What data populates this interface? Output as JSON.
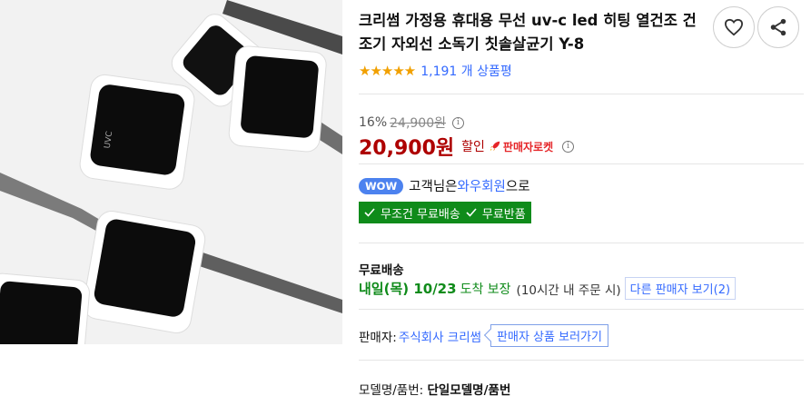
{
  "product": {
    "title": "크리썸 가정용 휴대용 무선 uv-c led 히팅 열건조 건조기 자외선 소독기 칫솔살균기 Y-8",
    "image_alt": "UVC 칫솔살균기 제품 이미지",
    "device_label": "UVC"
  },
  "actions": {
    "heart_icon": "heart-icon",
    "share_icon": "share-icon"
  },
  "rating": {
    "stars": "★★★★★",
    "review_count": "1,191 개 상품평"
  },
  "price": {
    "discount_rate": "16%",
    "original_price": "24,900원",
    "sale_price": "20,900원",
    "sale_tag": "할인",
    "seller_rocket": "판매자로켓"
  },
  "wow": {
    "badge": "WOW",
    "prefix": "고객님은",
    "link": "와우회원",
    "suffix": "으로"
  },
  "benefits": {
    "free_shipping": "무조건 무료배송",
    "free_return": "무료반품"
  },
  "shipping": {
    "title": "무료배송",
    "date": "내일(목) 10/23",
    "guarantee": "도착 보장",
    "note": "(10시간 내 주문 시)",
    "other_sellers_label": "다른 판매자 보기",
    "other_sellers_count": "(2)"
  },
  "seller": {
    "label": "판매자:",
    "name": "주식회사 크리썸",
    "button": "판매자 상품 보러가기"
  },
  "model": {
    "label": "모델명/품번:",
    "value": "단일모델명/품번"
  },
  "colors": {
    "price_red": "#ae0000",
    "link_blue": "#346aff",
    "rocket_green": "#0f8b1a",
    "star_orange": "#f1a000"
  }
}
